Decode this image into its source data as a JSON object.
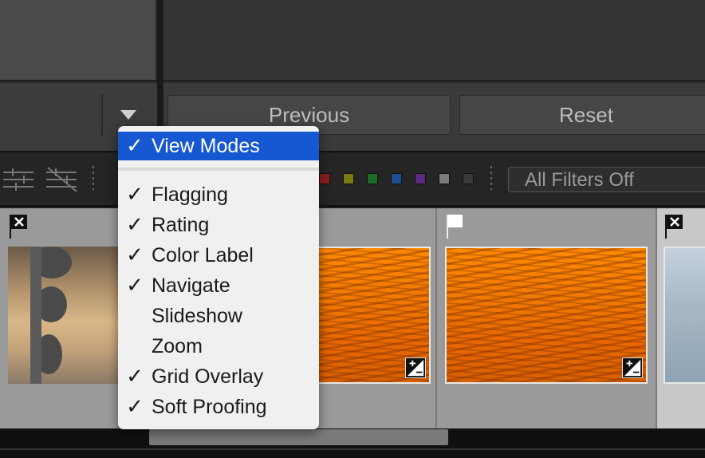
{
  "toolbar": {
    "previous_label": "Previous",
    "reset_label": "Reset"
  },
  "filter_bar": {
    "filter_select_value": "All Filters Off",
    "color_labels": [
      "#8a1e1e",
      "#7a7a14",
      "#1f6b28",
      "#1d4f8e",
      "#5d2b7e",
      "#7c7c7c",
      "#3a3a3a"
    ]
  },
  "view_menu": {
    "items": [
      {
        "label": "View Modes",
        "checked": true,
        "highlighted": true
      },
      {
        "label": "Flagging",
        "checked": true
      },
      {
        "label": "Rating",
        "checked": true
      },
      {
        "label": "Color Label",
        "checked": true
      },
      {
        "label": "Navigate",
        "checked": true
      },
      {
        "label": "Slideshow",
        "checked": false
      },
      {
        "label": "Zoom",
        "checked": false
      },
      {
        "label": "Grid Overlay",
        "checked": true
      },
      {
        "label": "Soft Proofing",
        "checked": true
      }
    ],
    "check_glyph": "✓"
  },
  "filmstrip": {
    "photos": [
      {
        "flag": "rejected",
        "style": "dusk"
      },
      {
        "flag": "none",
        "style": "sunset",
        "adjusted": true
      },
      {
        "flag": "picked",
        "style": "sunset",
        "adjusted": true
      },
      {
        "flag": "rejected",
        "style": "fog"
      }
    ]
  }
}
